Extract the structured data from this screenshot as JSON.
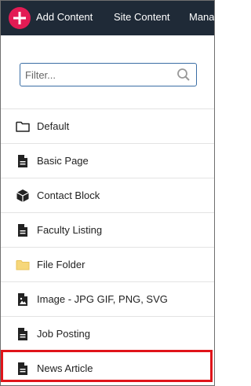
{
  "topbar": {
    "add_content_label": "Add Content",
    "site_content_label": "Site Content",
    "manage_label": "Mana"
  },
  "filter": {
    "placeholder": "Filter...",
    "value": ""
  },
  "items": [
    {
      "label": "Default",
      "icon": "folder-outline-icon"
    },
    {
      "label": "Basic Page",
      "icon": "document-icon"
    },
    {
      "label": "Contact Block",
      "icon": "box-icon"
    },
    {
      "label": "Faculty Listing",
      "icon": "document-icon"
    },
    {
      "label": "File Folder",
      "icon": "folder-yellow-icon"
    },
    {
      "label": "Image - JPG GIF, PNG, SVG",
      "icon": "image-file-icon"
    },
    {
      "label": "Job Posting",
      "icon": "document-icon"
    },
    {
      "label": "News Article",
      "icon": "document-icon"
    }
  ],
  "colors": {
    "topbar_bg": "#1f2a37",
    "add_button": "#e31b54",
    "highlight_border": "#e0141a",
    "folder_yellow": "#f6d77a"
  }
}
